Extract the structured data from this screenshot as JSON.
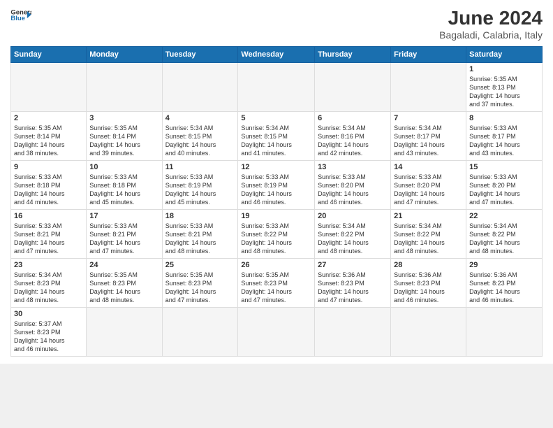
{
  "header": {
    "logo_general": "General",
    "logo_blue": "Blue",
    "month_title": "June 2024",
    "location": "Bagaladi, Calabria, Italy"
  },
  "weekdays": [
    "Sunday",
    "Monday",
    "Tuesday",
    "Wednesday",
    "Thursday",
    "Friday",
    "Saturday"
  ],
  "weeks": [
    [
      {
        "day": "",
        "info": ""
      },
      {
        "day": "",
        "info": ""
      },
      {
        "day": "",
        "info": ""
      },
      {
        "day": "",
        "info": ""
      },
      {
        "day": "",
        "info": ""
      },
      {
        "day": "",
        "info": ""
      },
      {
        "day": "1",
        "info": "Sunrise: 5:35 AM\nSunset: 8:13 PM\nDaylight: 14 hours\nand 37 minutes."
      }
    ],
    [
      {
        "day": "2",
        "info": "Sunrise: 5:35 AM\nSunset: 8:14 PM\nDaylight: 14 hours\nand 38 minutes."
      },
      {
        "day": "3",
        "info": "Sunrise: 5:35 AM\nSunset: 8:14 PM\nDaylight: 14 hours\nand 39 minutes."
      },
      {
        "day": "4",
        "info": "Sunrise: 5:34 AM\nSunset: 8:15 PM\nDaylight: 14 hours\nand 40 minutes."
      },
      {
        "day": "5",
        "info": "Sunrise: 5:34 AM\nSunset: 8:15 PM\nDaylight: 14 hours\nand 41 minutes."
      },
      {
        "day": "6",
        "info": "Sunrise: 5:34 AM\nSunset: 8:16 PM\nDaylight: 14 hours\nand 42 minutes."
      },
      {
        "day": "7",
        "info": "Sunrise: 5:34 AM\nSunset: 8:17 PM\nDaylight: 14 hours\nand 43 minutes."
      },
      {
        "day": "8",
        "info": "Sunrise: 5:33 AM\nSunset: 8:17 PM\nDaylight: 14 hours\nand 43 minutes."
      }
    ],
    [
      {
        "day": "9",
        "info": "Sunrise: 5:33 AM\nSunset: 8:18 PM\nDaylight: 14 hours\nand 44 minutes."
      },
      {
        "day": "10",
        "info": "Sunrise: 5:33 AM\nSunset: 8:18 PM\nDaylight: 14 hours\nand 45 minutes."
      },
      {
        "day": "11",
        "info": "Sunrise: 5:33 AM\nSunset: 8:19 PM\nDaylight: 14 hours\nand 45 minutes."
      },
      {
        "day": "12",
        "info": "Sunrise: 5:33 AM\nSunset: 8:19 PM\nDaylight: 14 hours\nand 46 minutes."
      },
      {
        "day": "13",
        "info": "Sunrise: 5:33 AM\nSunset: 8:20 PM\nDaylight: 14 hours\nand 46 minutes."
      },
      {
        "day": "14",
        "info": "Sunrise: 5:33 AM\nSunset: 8:20 PM\nDaylight: 14 hours\nand 47 minutes."
      },
      {
        "day": "15",
        "info": "Sunrise: 5:33 AM\nSunset: 8:20 PM\nDaylight: 14 hours\nand 47 minutes."
      }
    ],
    [
      {
        "day": "16",
        "info": "Sunrise: 5:33 AM\nSunset: 8:21 PM\nDaylight: 14 hours\nand 47 minutes."
      },
      {
        "day": "17",
        "info": "Sunrise: 5:33 AM\nSunset: 8:21 PM\nDaylight: 14 hours\nand 47 minutes."
      },
      {
        "day": "18",
        "info": "Sunrise: 5:33 AM\nSunset: 8:21 PM\nDaylight: 14 hours\nand 48 minutes."
      },
      {
        "day": "19",
        "info": "Sunrise: 5:33 AM\nSunset: 8:22 PM\nDaylight: 14 hours\nand 48 minutes."
      },
      {
        "day": "20",
        "info": "Sunrise: 5:34 AM\nSunset: 8:22 PM\nDaylight: 14 hours\nand 48 minutes."
      },
      {
        "day": "21",
        "info": "Sunrise: 5:34 AM\nSunset: 8:22 PM\nDaylight: 14 hours\nand 48 minutes."
      },
      {
        "day": "22",
        "info": "Sunrise: 5:34 AM\nSunset: 8:22 PM\nDaylight: 14 hours\nand 48 minutes."
      }
    ],
    [
      {
        "day": "23",
        "info": "Sunrise: 5:34 AM\nSunset: 8:23 PM\nDaylight: 14 hours\nand 48 minutes."
      },
      {
        "day": "24",
        "info": "Sunrise: 5:35 AM\nSunset: 8:23 PM\nDaylight: 14 hours\nand 48 minutes."
      },
      {
        "day": "25",
        "info": "Sunrise: 5:35 AM\nSunset: 8:23 PM\nDaylight: 14 hours\nand 47 minutes."
      },
      {
        "day": "26",
        "info": "Sunrise: 5:35 AM\nSunset: 8:23 PM\nDaylight: 14 hours\nand 47 minutes."
      },
      {
        "day": "27",
        "info": "Sunrise: 5:36 AM\nSunset: 8:23 PM\nDaylight: 14 hours\nand 47 minutes."
      },
      {
        "day": "28",
        "info": "Sunrise: 5:36 AM\nSunset: 8:23 PM\nDaylight: 14 hours\nand 46 minutes."
      },
      {
        "day": "29",
        "info": "Sunrise: 5:36 AM\nSunset: 8:23 PM\nDaylight: 14 hours\nand 46 minutes."
      }
    ],
    [
      {
        "day": "30",
        "info": "Sunrise: 5:37 AM\nSunset: 8:23 PM\nDaylight: 14 hours\nand 46 minutes."
      },
      {
        "day": "",
        "info": ""
      },
      {
        "day": "",
        "info": ""
      },
      {
        "day": "",
        "info": ""
      },
      {
        "day": "",
        "info": ""
      },
      {
        "day": "",
        "info": ""
      },
      {
        "day": "",
        "info": ""
      }
    ]
  ]
}
